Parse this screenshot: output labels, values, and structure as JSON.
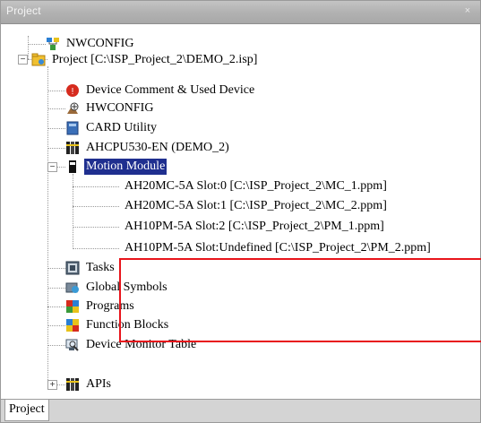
{
  "panel": {
    "title": "Project",
    "close_glyph": "×"
  },
  "tree": {
    "nwconfig": "NWCONFIG",
    "project": "Project [C:\\ISP_Project_2\\DEMO_2.isp]",
    "project_children": {
      "device_comment": "Device Comment & Used Device",
      "hwconfig": "HWCONFIG",
      "card_utility": "CARD Utility",
      "cpu": "AHCPU530-EN  (DEMO_2)",
      "motion_module": "Motion Module",
      "motion_children": [
        "AH20MC-5A Slot:0 [C:\\ISP_Project_2\\MC_1.ppm]",
        "AH20MC-5A Slot:1 [C:\\ISP_Project_2\\MC_2.ppm]",
        "AH10PM-5A Slot:2 [C:\\ISP_Project_2\\PM_1.ppm]",
        "AH10PM-5A Slot:Undefined [C:\\ISP_Project_2\\PM_2.ppm]"
      ],
      "tasks": "Tasks",
      "global_symbols": "Global Symbols",
      "programs": "Programs",
      "function_blocks": "Function Blocks",
      "device_monitor_table": "Device Monitor Table",
      "apis": "APIs"
    },
    "expander_collapsed": "+",
    "expander_expanded": "−"
  },
  "tabs": [
    "Project"
  ],
  "colors": {
    "selection": "#1f2f8f",
    "highlight_box": "#e8141b",
    "titlebar": "#b2b2b2"
  }
}
